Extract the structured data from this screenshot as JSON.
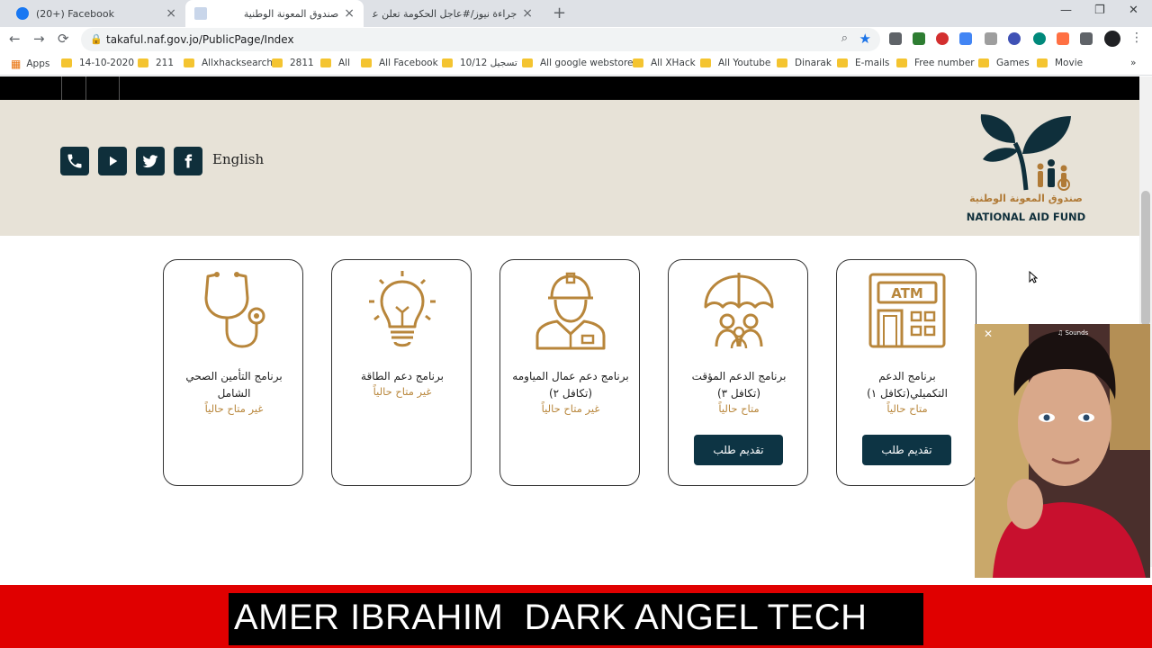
{
  "browser": {
    "tabs": [
      {
        "title": "(20+) Facebook",
        "close": "×"
      },
      {
        "title": "صندوق المعونة الوطنية",
        "close": "×"
      },
      {
        "title": "جراءة نيوز/#عاجل الحكومة تعلن عن",
        "close": "×"
      }
    ],
    "new_tab": "+",
    "window_controls": [
      "—",
      "❐",
      "✕"
    ],
    "nav": {
      "back": "←",
      "forward": "→",
      "reload": "⟳"
    },
    "url": "takaful.naf.gov.jo/PublicPage/Index"
  },
  "bookmarks": {
    "apps_label": "Apps",
    "items": [
      "14-10-2020",
      "211",
      "Allxhacksearch",
      "2811",
      "All",
      "All Facebook",
      "10/12 تسجيل",
      "All google webstore",
      "All XHack",
      "All Youtube",
      "Dinarak",
      "E-mails",
      "Free number",
      "Games",
      "Movie"
    ],
    "more": "»"
  },
  "header": {
    "language_link": "English",
    "social_icons": [
      "phone-icon",
      "youtube-icon",
      "twitter-icon",
      "facebook-icon"
    ],
    "logo_arabic": "صندوق المعونة الوطنية",
    "logo_english": "NATIONAL AID FUND"
  },
  "programs": [
    {
      "name": "برنامج التأمين الصحي الشامل",
      "status": "غير متاح حالياً",
      "icon": "stethoscope-icon"
    },
    {
      "name": "برنامج دعم الطاقة",
      "status": "غير متاح حالياً",
      "icon": "lightbulb-icon"
    },
    {
      "name": "برنامج دعم عمال المياومه (تكافل ٢)",
      "status": "غير متاح حالياً",
      "icon": "worker-icon"
    },
    {
      "name": "برنامج الدعم المؤقت (تكافل ٣)",
      "status": "متاح حالياً",
      "icon": "family-umbrella-icon",
      "button": "تقديم طلب"
    },
    {
      "name": "برنامج الدعم التكميلي(تكافل ١)",
      "status": "متاح حالياً",
      "icon": "atm-icon",
      "button": "تقديم طلب"
    }
  ],
  "overlay": {
    "close": "✕",
    "sounds": "♫ Sounds"
  },
  "banner": {
    "text": "AMER IBRAHIM  DARK ANGEL TECH"
  },
  "colors": {
    "accent": "#b8863b",
    "dark": "#0d3444",
    "header_bg": "#e7e2d7",
    "banner": "#e00000"
  }
}
